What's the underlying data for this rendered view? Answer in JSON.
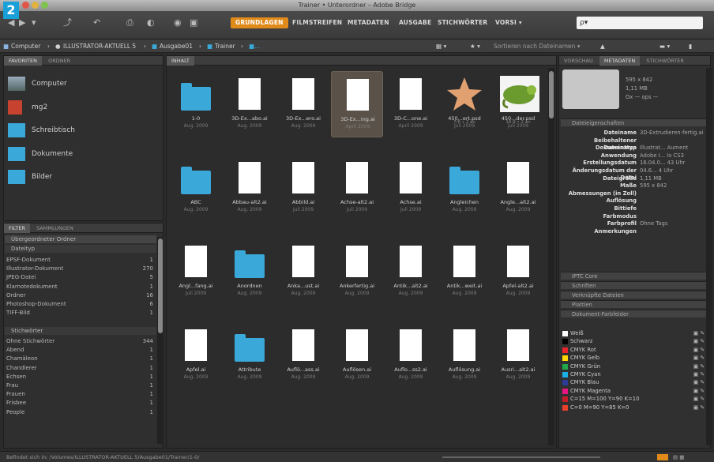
{
  "badge": "2",
  "window_title": "Trainer • Unterordner – Adobe Bridge",
  "toolbar": {
    "workspaces": [
      "GRUNDLAGEN",
      "FILMSTREIFEN",
      "METADATEN",
      "AUSGABE",
      "STICHWÖRTER",
      "VORSI ▾"
    ],
    "search_value": "ρ▾"
  },
  "path": {
    "crumbs": [
      "Computer",
      "ILLUSTRATOR-AKTUELL 5",
      "Ausgabe01",
      "Trainer",
      "■..."
    ],
    "sort_label": "Sortieren nach Dateinamen ▾"
  },
  "left_top": {
    "tabs": [
      "FAVORITEN",
      "ORDNER"
    ],
    "items": [
      "Computer",
      "mg2",
      "Schreibtisch",
      "Dokumente",
      "Bilder"
    ]
  },
  "filter": {
    "tabs": [
      "FILTER",
      "SAMMLUNGEN"
    ],
    "header": "Übergeordneter Ordner",
    "group1": "Dateityp",
    "rows1": [
      {
        "label": "EPSF-Dokument",
        "count": "1"
      },
      {
        "label": "Illustrator-Dokument",
        "count": "270"
      },
      {
        "label": "JPEG-Datei",
        "count": "5"
      },
      {
        "label": "Klarnotedokument",
        "count": "1"
      },
      {
        "label": "Ordner",
        "count": "16"
      },
      {
        "label": "Photoshop-Dokument",
        "count": "6"
      },
      {
        "label": "TIFF-Bild",
        "count": "1"
      }
    ],
    "group2": "Stichwörter",
    "rows2": [
      {
        "label": "Ohne Stichwörter",
        "count": "344"
      },
      {
        "label": "Abend",
        "count": "1"
      },
      {
        "label": "Chamäleon",
        "count": "1"
      },
      {
        "label": "Chandlerer",
        "count": "1"
      },
      {
        "label": "Echsen",
        "count": "1"
      },
      {
        "label": "Frau",
        "count": "1"
      },
      {
        "label": "Frauen",
        "count": "1"
      },
      {
        "label": "Frisbee",
        "count": "1"
      },
      {
        "label": "People",
        "count": "1"
      }
    ]
  },
  "content": {
    "tab": "INHALT",
    "items": [
      {
        "name": "1-0",
        "date": "Aug. 2009",
        "kind": "folder"
      },
      {
        "name": "3D-Ex...abo.ai",
        "date": "Aug. 2009",
        "kind": "doc"
      },
      {
        "name": "3D-Ex...ero.ai",
        "date": "Aug. 2009",
        "kind": "doc"
      },
      {
        "name": "3D-Ex...ing.ai",
        "date": "April 2009",
        "kind": "doc",
        "selected": true
      },
      {
        "name": "3D-C...one.ai",
        "date": "April 2009",
        "kind": "doc"
      },
      {
        "name": "450...ert.psd",
        "date": "Juli 2009",
        "extra": "7/6 • 2 an",
        "kind": "star"
      },
      {
        "name": "450...der.psd",
        "date": "Juli 2009",
        "extra": "16:9 • 2 an",
        "kind": "chameleon"
      },
      {
        "name": "ABC",
        "date": "Aug. 2009",
        "kind": "folder"
      },
      {
        "name": "Abbau-alt2.ai",
        "date": "Aug. 2009",
        "kind": "doc"
      },
      {
        "name": "Abbild.ai",
        "date": "Juli 2009",
        "kind": "doc"
      },
      {
        "name": "Achse-alt2.ai",
        "date": "Juli 2009",
        "kind": "doc"
      },
      {
        "name": "Achse.ai",
        "date": "Juli 2009",
        "kind": "doc"
      },
      {
        "name": "Angleichen",
        "date": "Aug. 2009",
        "kind": "folder"
      },
      {
        "name": "Angle...alt2.ai",
        "date": "Aug. 2009",
        "kind": "doc"
      },
      {
        "name": "Angl...fang.ai",
        "date": "Juli 2009",
        "kind": "doc"
      },
      {
        "name": "Anordnen",
        "date": "Aug. 2009",
        "kind": "folder"
      },
      {
        "name": "Anka...ust.ai",
        "date": "Aug. 2009",
        "kind": "doc"
      },
      {
        "name": "Ankerfertig.ai",
        "date": "Aug. 2009",
        "kind": "doc"
      },
      {
        "name": "Antik...alt2.ai",
        "date": "Aug. 2009",
        "kind": "doc"
      },
      {
        "name": "Antik...weit.ai",
        "date": "Aug. 2009",
        "kind": "doc"
      },
      {
        "name": "Apfel-alt2.ai",
        "date": "Aug. 2009",
        "kind": "doc"
      },
      {
        "name": "Apfel.ai",
        "date": "Aug. 2009",
        "kind": "doc"
      },
      {
        "name": "Attribute",
        "date": "Aug. 2009",
        "kind": "folder"
      },
      {
        "name": "Auflö...ass.ai",
        "date": "Aug. 2009",
        "kind": "doc"
      },
      {
        "name": "Auflösen.ai",
        "date": "Aug. 2009",
        "kind": "doc"
      },
      {
        "name": "Auflo...ss2.ai",
        "date": "Aug. 2009",
        "kind": "doc"
      },
      {
        "name": "Auflösung.ai",
        "date": "Aug. 2009",
        "kind": "doc"
      },
      {
        "name": "Ausri...alt2.ai",
        "date": "Aug. 2009",
        "kind": "doc"
      }
    ]
  },
  "right": {
    "tabs": [
      "VORSCHAU",
      "METADATEN",
      "STICHWÖRTER"
    ],
    "preview_info": [
      "595 x 842",
      "1,11 MB",
      "Ox — ops —"
    ],
    "section": "Dateieigenschaften",
    "meta": [
      {
        "k": "Dateiname",
        "v": "3D-Extrudieren-fertig.ai"
      },
      {
        "k": "Beibehaltener Dateiname",
        "v": ""
      },
      {
        "k": "Dokumenttyp",
        "v": "Illustrat... Aument"
      },
      {
        "k": "Anwendung",
        "v": "Adobe I... lo CS3"
      },
      {
        "k": "Erstellungsdatum",
        "v": "16.04.0... 43 Uhr"
      },
      {
        "k": "Änderungsdatum der Datei",
        "v": "04.6... 4 Uhr"
      },
      {
        "k": "Dateigröße",
        "v": "1,11 MB"
      },
      {
        "k": "Maße",
        "v": "595 x 842"
      },
      {
        "k": "Abmessungen (in Zoll)",
        "v": ""
      },
      {
        "k": "Auflösung",
        "v": ""
      },
      {
        "k": "Bittiefe",
        "v": ""
      },
      {
        "k": "Farbmodus",
        "v": ""
      },
      {
        "k": "Farbprofil",
        "v": "Ohne Tags"
      },
      {
        "k": "Anmerkungen",
        "v": ""
      }
    ],
    "sections": [
      "IPTC Core",
      "Schriften",
      "Verknüpfte Dateien",
      "Plattien",
      "Dokument-Farbfelder"
    ],
    "swatches": [
      {
        "name": "Weiß",
        "color": "#ffffff"
      },
      {
        "name": "Schwarz",
        "color": "#000000"
      },
      {
        "name": "CMYK Rot",
        "color": "#e8232a"
      },
      {
        "name": "CMYK Gelb",
        "color": "#ffd700"
      },
      {
        "name": "CMYK Grün",
        "color": "#21a84a"
      },
      {
        "name": "CMYK Cyan",
        "color": "#1ab0e6"
      },
      {
        "name": "CMYK Blau",
        "color": "#2d3a96"
      },
      {
        "name": "CMYK Magenta",
        "color": "#e6157f"
      },
      {
        "name": "C=15 M=100 Y=90 K=10",
        "color": "#c21c2b"
      },
      {
        "name": "C=0 M=90 Y=85 K=0",
        "color": "#e8402c"
      }
    ]
  },
  "status": "Befindet sich in: /Volumes/ILLUSTRATOR-AKTUELL 5/Ausgabe01/Trainer/1-0/"
}
